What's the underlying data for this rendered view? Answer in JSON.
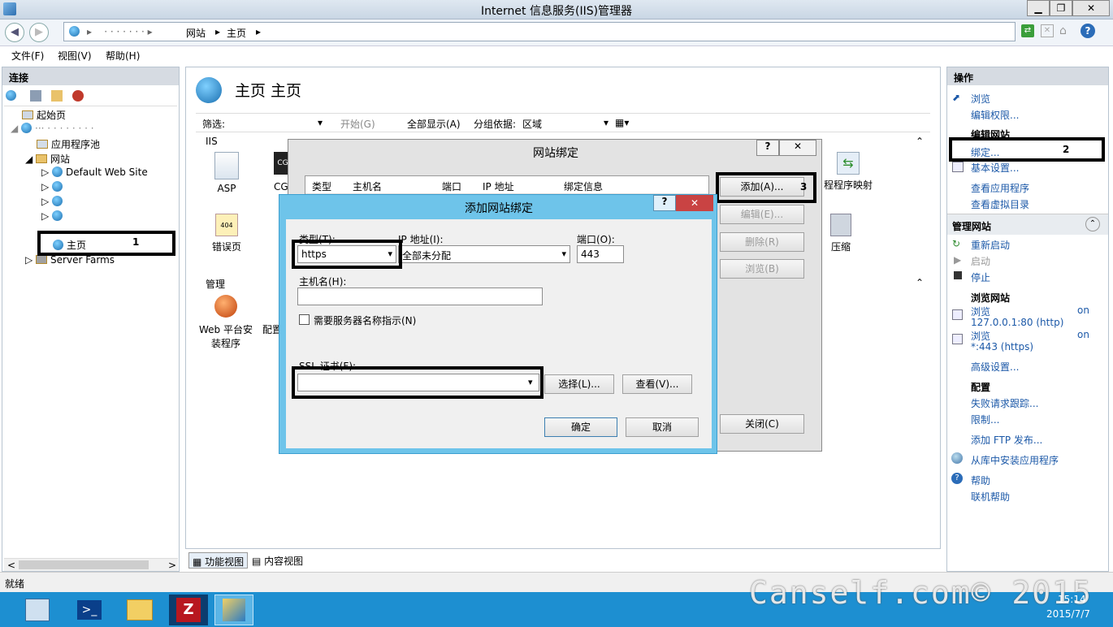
{
  "window": {
    "title": "Internet 信息服务(IIS)管理器",
    "min": "▁",
    "max": "❐",
    "close": "✕"
  },
  "address": {
    "segments": [
      "网站",
      "主页"
    ],
    "sep": "▸"
  },
  "menu": [
    "文件(F)",
    "视图(V)",
    "帮助(H)"
  ],
  "connections": {
    "header": "连接",
    "tree": {
      "start_page": "起始页",
      "app_pools": "应用程序池",
      "sites": "网站",
      "default_site": "Default Web Site",
      "homepage": "主页",
      "server_farms": "Server Farms"
    },
    "annotation1": "1"
  },
  "center": {
    "title": "主页 主页",
    "filter_label": "筛选:",
    "start": "开始(G)",
    "show_all": "全部显示(A)",
    "group_by_label": "分组依据:",
    "group_by_value": "区域",
    "section_iis": "IIS",
    "section_manage": "管理",
    "icons": {
      "asp": "ASP",
      "cg": "CG",
      "error_pages": "错误页",
      "redirect": "程程序映射",
      "compress": "压缩",
      "webpi": "Web 平台安装程序",
      "config": "配置"
    },
    "tabs": {
      "features": "功能视图",
      "content": "内容视图"
    }
  },
  "site_binding_dialog": {
    "title": "网站绑定",
    "columns": [
      "类型",
      "主机名",
      "端口",
      "IP 地址",
      "绑定信息"
    ],
    "buttons": {
      "add": "添加(A)...",
      "edit": "编辑(E)...",
      "remove": "删除(R)",
      "browse": "浏览(B)",
      "close": "关闭(C)"
    },
    "annotation3": "3",
    "help": "?",
    "x": "✕"
  },
  "add_binding_dialog": {
    "title": "添加网站绑定",
    "type_label": "类型(T):",
    "type_value": "https",
    "ip_label": "IP 地址(I):",
    "ip_value": "全部未分配",
    "port_label": "端口(O):",
    "port_value": "443",
    "host_label": "主机名(H):",
    "host_value": "",
    "sni_label": "需要服务器名称指示(N)",
    "ssl_label": "SSL 证书(F):",
    "ssl_value": "",
    "select_btn": "选择(L)...",
    "view_btn": "查看(V)...",
    "ok_btn": "确定",
    "cancel_btn": "取消",
    "help": "?",
    "x": "✕"
  },
  "actions": {
    "header": "操作",
    "browse": "浏览",
    "edit_perms": "编辑权限...",
    "edit_site_header": "编辑网站",
    "bindings": "绑定...",
    "annotation2": "2",
    "basic_settings": "基本设置...",
    "view_apps": "查看应用程序",
    "view_vdirs": "查看虚拟目录",
    "manage_site_header": "管理网站",
    "restart": "重新启动",
    "start": "启动",
    "stop": "停止",
    "browse_site_header": "浏览网站",
    "browse1": "浏览",
    "browse1_suffix": "on",
    "browse1_addr": "127.0.0.1:80 (http)",
    "browse2": "浏览",
    "browse2_suffix": "on",
    "browse2_addr": "*:443 (https)",
    "advanced": "高级设置...",
    "config_header": "配置",
    "failed_req": "失败请求跟踪...",
    "limits": "限制...",
    "ftp": "添加 FTP 发布...",
    "gallery": "从库中安装应用程序",
    "help": "帮助",
    "online_help": "联机帮助"
  },
  "status": {
    "text": "就绪"
  },
  "watermark": "Canself.com© 2015",
  "clock": {
    "time": "15:14",
    "date": "2015/7/7"
  }
}
